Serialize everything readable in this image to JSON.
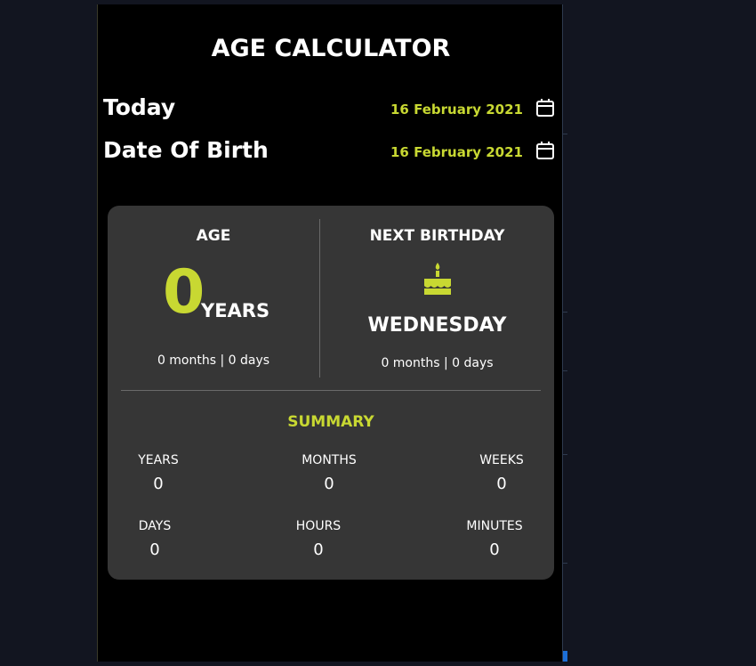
{
  "app": {
    "title": "AGE CALCULATOR",
    "today_label": "Today",
    "today_date": "16 February 2021",
    "dob_label": "Date Of Birth",
    "dob_date": "16 February 2021"
  },
  "age": {
    "heading": "AGE",
    "years": "0",
    "unit": "YEARS",
    "detail": "0 months | 0 days"
  },
  "next_birthday": {
    "heading": "NEXT BIRTHDAY",
    "icon": "birthday-cake-icon",
    "weekday": "WEDNESDAY",
    "detail": "0 months | 0 days"
  },
  "summary": {
    "heading": "SUMMARY",
    "stats": [
      {
        "label": "YEARS",
        "value": "0"
      },
      {
        "label": "MONTHS",
        "value": "0"
      },
      {
        "label": "WEEKS",
        "value": "0"
      },
      {
        "label": "DAYS",
        "value": "0"
      },
      {
        "label": "HOURS",
        "value": "0"
      },
      {
        "label": "MINUTES",
        "value": "0"
      }
    ]
  },
  "colors": {
    "accent": "#c8d832",
    "background": "#000000",
    "card": "#363636",
    "page": "#121520"
  }
}
